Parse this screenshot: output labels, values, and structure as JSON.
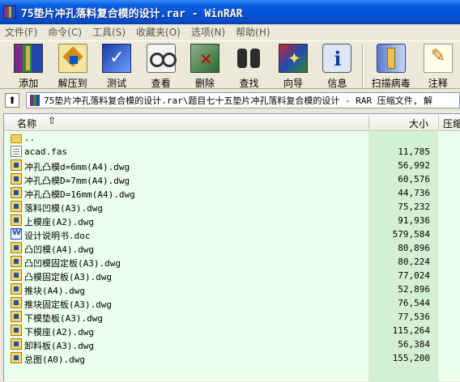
{
  "window": {
    "title": "75垫片冲孔落料复合模的设计.rar - WinRAR"
  },
  "menu": [
    {
      "label": "文件(F)"
    },
    {
      "label": "命令(C)"
    },
    {
      "label": "工具(S)"
    },
    {
      "label": "收藏夹(O)"
    },
    {
      "label": "选项(N)"
    },
    {
      "label": "帮助(H)"
    }
  ],
  "toolbar": [
    {
      "label": "添加",
      "icon": "add-books-icon"
    },
    {
      "label": "解压到",
      "icon": "extract-icon"
    },
    {
      "label": "测试",
      "icon": "test-icon"
    },
    {
      "label": "查看",
      "icon": "view-icon"
    },
    {
      "label": "删除",
      "icon": "delete-icon"
    },
    {
      "label": "查找",
      "icon": "find-icon"
    },
    {
      "label": "向导",
      "icon": "wizard-icon"
    },
    {
      "label": "信息",
      "icon": "info-icon"
    },
    {
      "label": "扫描病毒",
      "icon": "scan-virus-icon"
    },
    {
      "label": "注释",
      "icon": "comment-icon"
    }
  ],
  "address": {
    "path": "75垫片冲孔落料复合模的设计.rar\\题目七十五垫片冲孔落料复合模的设计 - RAR 压缩文件, 解"
  },
  "columns": {
    "name": "名称",
    "size": "大小",
    "packed": "压缩后"
  },
  "files": [
    {
      "name": "..",
      "size": "",
      "type": "folder"
    },
    {
      "name": "acad.fas",
      "size": "11,785",
      "type": "fas"
    },
    {
      "name": "冲孔凸模d=6mm(A4).dwg",
      "size": "56,992",
      "type": "dwg"
    },
    {
      "name": "冲孔凸模D=7mm(A4).dwg",
      "size": "60,576",
      "type": "dwg"
    },
    {
      "name": "冲孔凸模D=16mm(A4).dwg",
      "size": "44,736",
      "type": "dwg"
    },
    {
      "name": "落料凹模(A3).dwg",
      "size": "75,232",
      "type": "dwg"
    },
    {
      "name": "上模座(A2).dwg",
      "size": "91,936",
      "type": "dwg"
    },
    {
      "name": "设计说明书.doc",
      "size": "579,584",
      "type": "doc"
    },
    {
      "name": "凸凹模(A4).dwg",
      "size": "80,896",
      "type": "dwg"
    },
    {
      "name": "凸凹模固定板(A3).dwg",
      "size": "80,224",
      "type": "dwg"
    },
    {
      "name": "凸模固定板(A3).dwg",
      "size": "77,024",
      "type": "dwg"
    },
    {
      "name": "推块(A4).dwg",
      "size": "52,896",
      "type": "dwg"
    },
    {
      "name": "推块固定板(A3).dwg",
      "size": "76,544",
      "type": "dwg"
    },
    {
      "name": "下模垫板(A3).dwg",
      "size": "77,536",
      "type": "dwg"
    },
    {
      "name": "下模座(A2).dwg",
      "size": "115,264",
      "type": "dwg"
    },
    {
      "name": "卸料板(A3).dwg",
      "size": "56,384",
      "type": "dwg"
    },
    {
      "name": "总图(A0).dwg",
      "size": "155,200",
      "type": "dwg"
    }
  ],
  "colors": {
    "title_bar": "#0653d6",
    "list_background": "#ecffec",
    "size_column": "#d4f0d4"
  }
}
